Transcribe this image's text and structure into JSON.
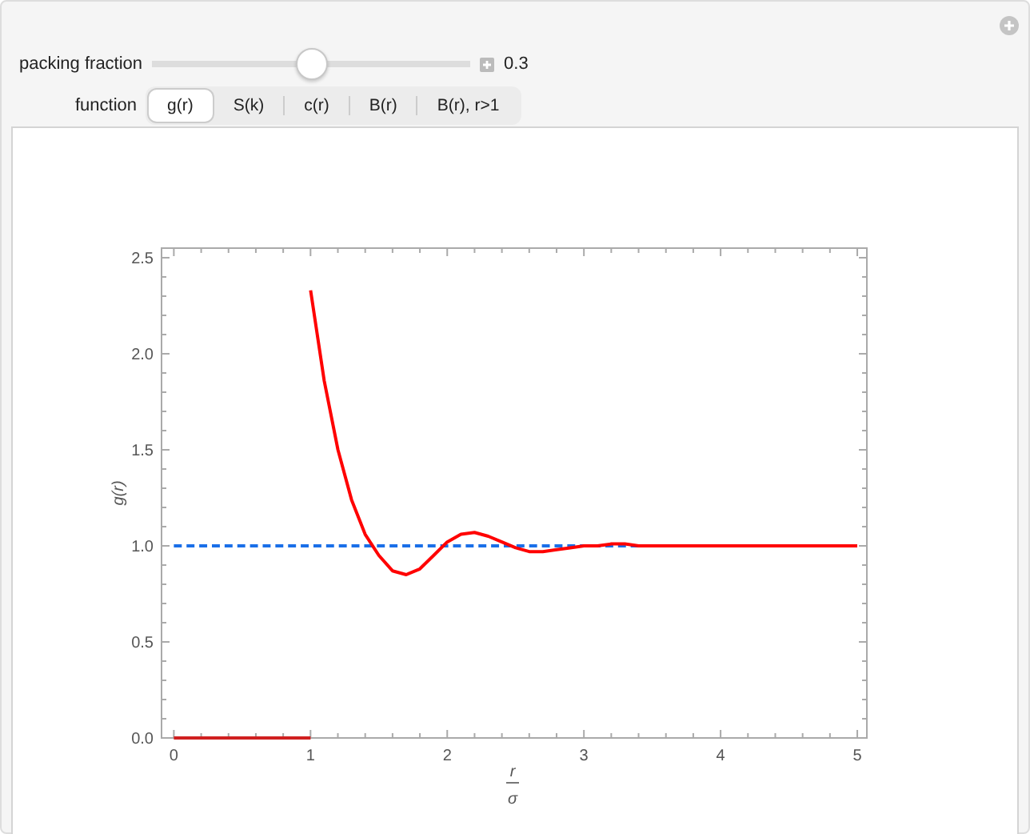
{
  "controls": {
    "slider": {
      "label": "packing fraction",
      "level": 0.5,
      "reading": "0.3"
    },
    "function_label": "function",
    "tabs": [
      {
        "label": "g(r)",
        "selected": true
      },
      {
        "label": "S(k)",
        "selected": false
      },
      {
        "label": "c(r)",
        "selected": false
      },
      {
        "label": "B(r)",
        "selected": false
      },
      {
        "label": "B(r), r>1",
        "selected": false
      }
    ]
  },
  "plot": {
    "x_axis_label": {
      "numerator": "r",
      "denominator": "σ"
    },
    "chart_data": {
      "type": "line",
      "ylabel": "g(r)",
      "xlim": [
        -0.09,
        5.07
      ],
      "ylim": [
        0,
        2.55
      ],
      "xticks": [
        0,
        1,
        2,
        3,
        4,
        5
      ],
      "yticks": [
        {
          "value": 0,
          "label": "0.0"
        },
        {
          "value": 0.5,
          "label": "0.5"
        },
        {
          "value": 1,
          "label": "1.0"
        },
        {
          "value": 1.5,
          "label": "1.5"
        },
        {
          "value": 2,
          "label": "2.0"
        },
        {
          "value": 2.5,
          "label": "2.5"
        }
      ],
      "x": [
        0,
        0.5,
        1.0,
        1.0,
        1.1,
        1.2,
        1.3,
        1.4,
        1.5,
        1.6,
        1.7,
        1.8,
        1.9,
        2.0,
        2.1,
        2.2,
        2.3,
        2.4,
        2.5,
        2.6,
        2.7,
        2.8,
        2.9,
        3.0,
        3.1,
        3.2,
        3.3,
        3.4,
        3.5,
        3.6,
        3.7,
        3.8,
        3.9,
        4.0,
        4.1,
        4.2,
        4.3,
        4.4,
        4.5,
        4.6,
        4.7,
        4.8,
        4.9,
        5.0
      ],
      "series": [
        {
          "color": "#1a6fe8",
          "line_style": "dashed",
          "values": [
            1,
            1,
            1,
            1,
            1,
            1,
            1,
            1,
            1,
            1,
            1,
            1,
            1,
            1,
            1,
            1,
            1,
            1,
            1,
            1,
            1,
            1,
            1,
            1,
            1,
            1,
            1,
            1,
            null,
            null,
            null,
            null,
            null,
            null,
            null,
            null,
            null,
            null,
            null,
            null,
            null,
            null,
            null,
            null
          ]
        },
        {
          "color": "#d02020",
          "line_style": "solid",
          "values": [
            0,
            0,
            0,
            null,
            null,
            null,
            null,
            null,
            null,
            null,
            null,
            null,
            null,
            null,
            null,
            null,
            null,
            null,
            null,
            null,
            null,
            null,
            null,
            null,
            null,
            null,
            null,
            null,
            null,
            null,
            null,
            null,
            null,
            null,
            null,
            null,
            null,
            null,
            null,
            null,
            null,
            null,
            null,
            null
          ]
        },
        {
          "color": "#ff0000",
          "line_style": "solid",
          "values": [
            null,
            null,
            null,
            2.33,
            1.86,
            1.5,
            1.24,
            1.06,
            0.95,
            0.87,
            0.85,
            0.88,
            0.95,
            1.02,
            1.06,
            1.07,
            1.05,
            1.02,
            0.99,
            0.97,
            0.97,
            0.98,
            0.99,
            1.0,
            1.0,
            1.01,
            1.01,
            1.0,
            1.0,
            1.0,
            1.0,
            1.0,
            1.0,
            1.0,
            1.0,
            1.0,
            1.0,
            1.0,
            1.0,
            1.0,
            1.0,
            1.0,
            1.0,
            1.0
          ]
        }
      ]
    }
  }
}
